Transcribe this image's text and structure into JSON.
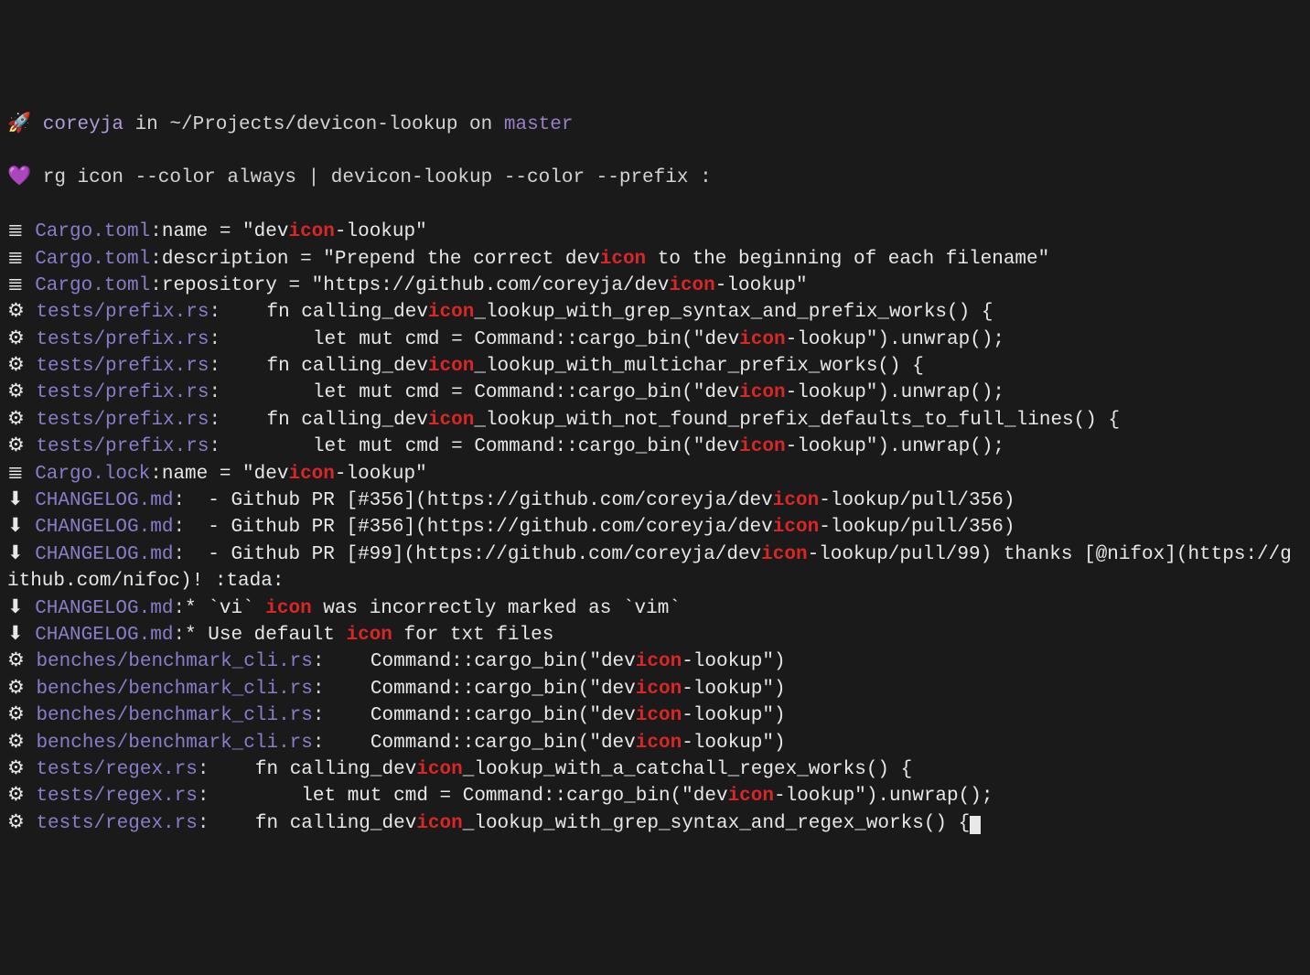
{
  "prompt": {
    "rocket": "🚀 ",
    "user": "coreyja",
    "in": " in ",
    "path": "~/Projects/devicon-lookup",
    "on": " on ",
    "branch": "master",
    "heart": "💜 ",
    "command": "rg icon --color always | devicon-lookup --color --prefix :"
  },
  "icons": {
    "config": "≣",
    "rust": "⚙",
    "md": "⬇"
  },
  "lines": [
    {
      "icon": "config",
      "file": "Cargo.toml",
      "parts": [
        {
          "t": "name = \"dev"
        },
        {
          "t": "icon",
          "hl": true
        },
        {
          "t": "-lookup\""
        }
      ]
    },
    {
      "icon": "config",
      "file": "Cargo.toml",
      "parts": [
        {
          "t": "description = \"Prepend the correct dev"
        },
        {
          "t": "icon",
          "hl": true
        },
        {
          "t": " to the beginning of each filename\""
        }
      ]
    },
    {
      "icon": "config",
      "file": "Cargo.toml",
      "parts": [
        {
          "t": "repository = \"https://github.com/coreyja/dev"
        },
        {
          "t": "icon",
          "hl": true
        },
        {
          "t": "-lookup\""
        }
      ]
    },
    {
      "icon": "rust",
      "file": "tests/prefix.rs",
      "parts": [
        {
          "t": "    fn calling_dev"
        },
        {
          "t": "icon",
          "hl": true
        },
        {
          "t": "_lookup_with_grep_syntax_and_prefix_works() {"
        }
      ]
    },
    {
      "icon": "rust",
      "file": "tests/prefix.rs",
      "parts": [
        {
          "t": "        let mut cmd = Command::cargo_bin(\"dev"
        },
        {
          "t": "icon",
          "hl": true
        },
        {
          "t": "-lookup\").unwrap();"
        }
      ]
    },
    {
      "icon": "rust",
      "file": "tests/prefix.rs",
      "parts": [
        {
          "t": "    fn calling_dev"
        },
        {
          "t": "icon",
          "hl": true
        },
        {
          "t": "_lookup_with_multichar_prefix_works() {"
        }
      ]
    },
    {
      "icon": "rust",
      "file": "tests/prefix.rs",
      "parts": [
        {
          "t": "        let mut cmd = Command::cargo_bin(\"dev"
        },
        {
          "t": "icon",
          "hl": true
        },
        {
          "t": "-lookup\").unwrap();"
        }
      ]
    },
    {
      "icon": "rust",
      "file": "tests/prefix.rs",
      "parts": [
        {
          "t": "    fn calling_dev"
        },
        {
          "t": "icon",
          "hl": true
        },
        {
          "t": "_lookup_with_not_found_prefix_defaults_to_full_lines() {"
        }
      ]
    },
    {
      "icon": "rust",
      "file": "tests/prefix.rs",
      "parts": [
        {
          "t": "        let mut cmd = Command::cargo_bin(\"dev"
        },
        {
          "t": "icon",
          "hl": true
        },
        {
          "t": "-lookup\").unwrap();"
        }
      ]
    },
    {
      "icon": "config",
      "file": "Cargo.lock",
      "parts": [
        {
          "t": "name = \"dev"
        },
        {
          "t": "icon",
          "hl": true
        },
        {
          "t": "-lookup\""
        }
      ]
    },
    {
      "icon": "md",
      "file": "CHANGELOG.md",
      "parts": [
        {
          "t": "  - Github PR [#356](https://github.com/coreyja/dev"
        },
        {
          "t": "icon",
          "hl": true
        },
        {
          "t": "-lookup/pull/356)"
        }
      ]
    },
    {
      "icon": "md",
      "file": "CHANGELOG.md",
      "parts": [
        {
          "t": "  - Github PR [#356](https://github.com/coreyja/dev"
        },
        {
          "t": "icon",
          "hl": true
        },
        {
          "t": "-lookup/pull/356)"
        }
      ]
    },
    {
      "icon": "md",
      "file": "CHANGELOG.md",
      "parts": [
        {
          "t": "  - Github PR [#99](https://github.com/coreyja/dev"
        },
        {
          "t": "icon",
          "hl": true
        },
        {
          "t": "-lookup/pull/99) thanks [@nifox](https://github.com/nifoc)! :tada:"
        }
      ]
    },
    {
      "icon": "md",
      "file": "CHANGELOG.md",
      "parts": [
        {
          "t": "* `vi` "
        },
        {
          "t": "icon",
          "hl": true
        },
        {
          "t": " was incorrectly marked as `vim`"
        }
      ]
    },
    {
      "icon": "md",
      "file": "CHANGELOG.md",
      "parts": [
        {
          "t": "* Use default "
        },
        {
          "t": "icon",
          "hl": true
        },
        {
          "t": " for txt files"
        }
      ]
    },
    {
      "icon": "rust",
      "file": "benches/benchmark_cli.rs",
      "parts": [
        {
          "t": "    Command::cargo_bin(\"dev"
        },
        {
          "t": "icon",
          "hl": true
        },
        {
          "t": "-lookup\")"
        }
      ]
    },
    {
      "icon": "rust",
      "file": "benches/benchmark_cli.rs",
      "parts": [
        {
          "t": "    Command::cargo_bin(\"dev"
        },
        {
          "t": "icon",
          "hl": true
        },
        {
          "t": "-lookup\")"
        }
      ]
    },
    {
      "icon": "rust",
      "file": "benches/benchmark_cli.rs",
      "parts": [
        {
          "t": "    Command::cargo_bin(\"dev"
        },
        {
          "t": "icon",
          "hl": true
        },
        {
          "t": "-lookup\")"
        }
      ]
    },
    {
      "icon": "rust",
      "file": "benches/benchmark_cli.rs",
      "parts": [
        {
          "t": "    Command::cargo_bin(\"dev"
        },
        {
          "t": "icon",
          "hl": true
        },
        {
          "t": "-lookup\")"
        }
      ]
    },
    {
      "icon": "rust",
      "file": "tests/regex.rs",
      "parts": [
        {
          "t": "    fn calling_dev"
        },
        {
          "t": "icon",
          "hl": true
        },
        {
          "t": "_lookup_with_a_catchall_regex_works() {"
        }
      ]
    },
    {
      "icon": "rust",
      "file": "tests/regex.rs",
      "parts": [
        {
          "t": "        let mut cmd = Command::cargo_bin(\"dev"
        },
        {
          "t": "icon",
          "hl": true
        },
        {
          "t": "-lookup\").unwrap();"
        }
      ]
    },
    {
      "icon": "rust",
      "file": "tests/regex.rs",
      "parts": [
        {
          "t": "    fn calling_dev"
        },
        {
          "t": "icon",
          "hl": true
        },
        {
          "t": "_lookup_with_grep_syntax_and_regex_works() {"
        }
      ],
      "cursor": true
    }
  ]
}
